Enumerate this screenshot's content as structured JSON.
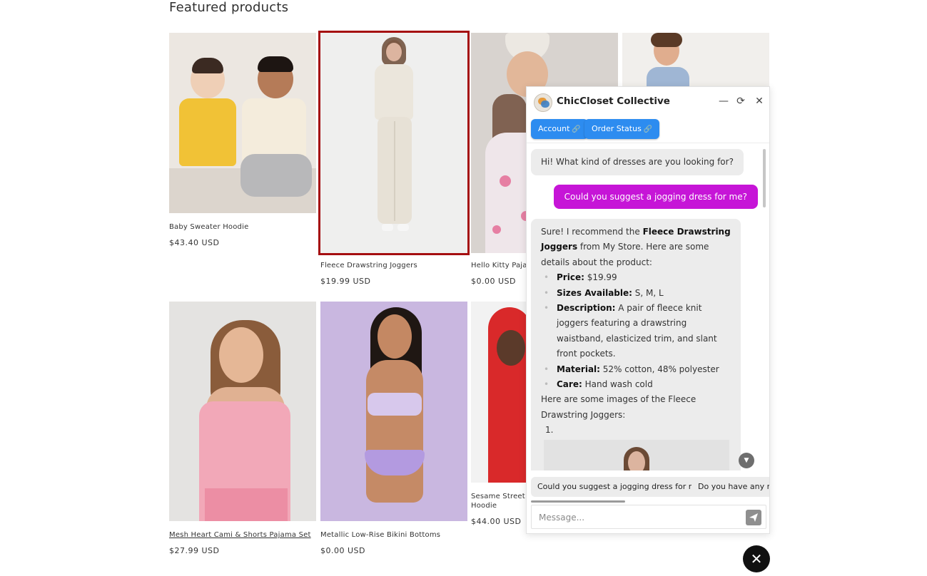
{
  "section": {
    "title": "Featured products"
  },
  "products": [
    {
      "name": "Baby Sweater Hoodie",
      "price": "$43.40 USD"
    },
    {
      "name": "Fleece Drawstring Joggers",
      "price": "$19.99 USD"
    },
    {
      "name": "Hello Kitty Pajam",
      "price": "$0.00 USD"
    },
    {
      "name": "Mesh Heart Cami & Shorts Pajama Set",
      "price": "$27.99 USD"
    },
    {
      "name": "Metallic Low-Rise Bikini Bottoms",
      "price": "$0.00 USD"
    },
    {
      "name": "Sesame Street Fr\nHoodie",
      "price": "$44.00 USD"
    }
  ],
  "chat": {
    "brand": "ChicCloset Collective",
    "controls": {
      "minimize": "—",
      "refresh": "⟳",
      "close": "✕"
    },
    "quick_links": [
      {
        "label": "Account",
        "icon": "🔗"
      },
      {
        "label": "Order Status",
        "icon": "🔗"
      }
    ],
    "messages": {
      "bot1": "Hi! What kind of dresses are you looking for?",
      "user1": "Could you suggest a jogging dress for me?",
      "bot2": {
        "intro_pre": "Sure! I recommend the ",
        "intro_bold": "Fleece Drawstring Joggers",
        "intro_post": " from My Store. Here are some details about the product:",
        "details": [
          {
            "label": "Price:",
            "value": " $19.99"
          },
          {
            "label": "Sizes Available:",
            "value": " S, M, L"
          },
          {
            "label": "Description:",
            "value": " A pair of fleece knit joggers featuring a drawstring waistband, elasticized trim, and slant front pockets."
          },
          {
            "label": "Material:",
            "value": " 52% cotton, 48% polyester"
          },
          {
            "label": "Care:",
            "value": " Hand wash cold"
          }
        ],
        "images_intro": "Here are some images of the Fleece Drawstring Joggers:",
        "list_number": "1."
      }
    },
    "suggestions": [
      "Could you suggest a jogging dress for me?",
      "Do you have any rec"
    ],
    "input": {
      "placeholder": "Message..."
    },
    "send_icon": "paper-plane-icon",
    "scroll_down_icon": "▼"
  },
  "fab": {
    "close_icon": "✕"
  },
  "colors": {
    "selected_outline": "#a50e10",
    "quick_link": "#2d8cf0",
    "user_bubble": "#c615d7"
  }
}
